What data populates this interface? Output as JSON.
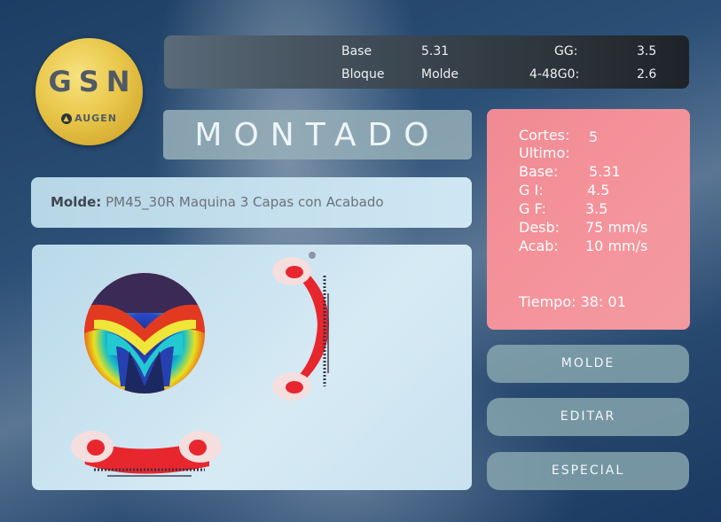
{
  "logo": {
    "text": "GSN",
    "sub": "AUGEN"
  },
  "topbar": {
    "base_label": "Base",
    "base_value": "5.31",
    "gg_label": "GG:",
    "gg_value": "3.5",
    "bloque_label": "Bloque",
    "bloque_value": "Molde",
    "code_label": "4-48G0:",
    "code_value": "2.6"
  },
  "status": "MONTADO",
  "molde": {
    "label": "Molde:",
    "value": "PM45_30R Maquina 3 Capas con Acabado"
  },
  "info": {
    "cortes_label": "Cortes:",
    "cortes_value": "5",
    "ultimo_label": "Ultimo:",
    "base_label": "Base:",
    "base_value": "5.31",
    "gi_label": "G I:",
    "gi_value": "4.5",
    "gf_label": "G F:",
    "gf_value": "3.5",
    "desb_label": "Desb:",
    "desb_value": "75 mm/s",
    "acab_label": "Acab:",
    "acab_value": "10 mm/s",
    "tiempo": "Tiempo: 38: 01"
  },
  "buttons": {
    "molde": "MOLDE",
    "editar": "EDITAR",
    "especial": "ESPECIAL"
  }
}
